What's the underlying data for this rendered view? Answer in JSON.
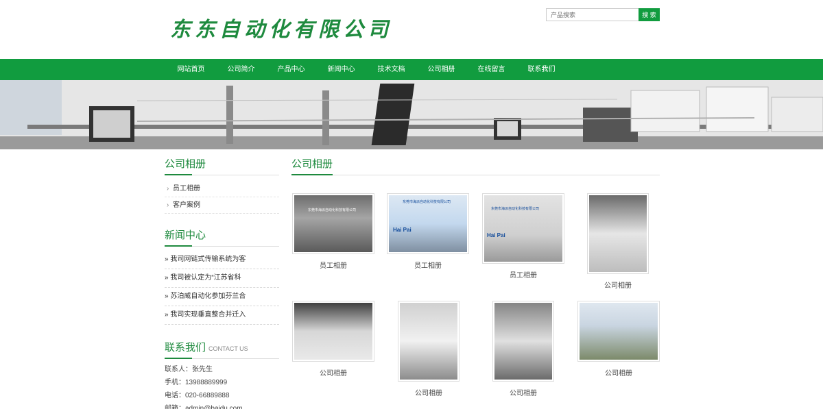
{
  "header": {
    "logo_text": "东东自动化有限公司",
    "search_placeholder": "产品搜索",
    "search_button": "搜 索"
  },
  "nav": [
    "网站首页",
    "公司简介",
    "产品中心",
    "新闻中心",
    "技术文档",
    "公司相册",
    "在线留言",
    "联系我们"
  ],
  "sidebar": {
    "album_title": "公司相册",
    "album_items": [
      "员工相册",
      "客户案例"
    ],
    "news_title": "新闻中心",
    "news_items": [
      "» 我司网链式传输系统为客",
      "» 我司被认定为“江苏省科",
      "» 苏泊威自动化参加芬兰合",
      "» 我司实现垂直整合并迁入"
    ],
    "contact_title": "联系我们",
    "contact_sub": "CONTACT US",
    "contact": [
      "联系人：张先生",
      "手机：13988889999",
      "电话：020-66889888",
      "邮箱：admin@baidu.com"
    ]
  },
  "main": {
    "title": "公司相册",
    "photos": [
      {
        "caption": "员工相册"
      },
      {
        "caption": "员工相册"
      },
      {
        "caption": "员工相册"
      },
      {
        "caption": "公司相册"
      },
      {
        "caption": "公司相册"
      },
      {
        "caption": "公司相册"
      },
      {
        "caption": "公司相册"
      },
      {
        "caption": "公司相册"
      }
    ]
  },
  "photo_texts": {
    "p1_banner": "东莞市海派自动化科技有限公司",
    "p2_banner": "东莞市海派自动化科技有限公司",
    "p2_sub": "Hai Pai",
    "p3_banner": "东莞市海派自动化科技有限公司",
    "p3_sub": "Hai Pai"
  },
  "colors": {
    "brand_green": "#119c3f",
    "title_green": "#1e8a3e"
  }
}
